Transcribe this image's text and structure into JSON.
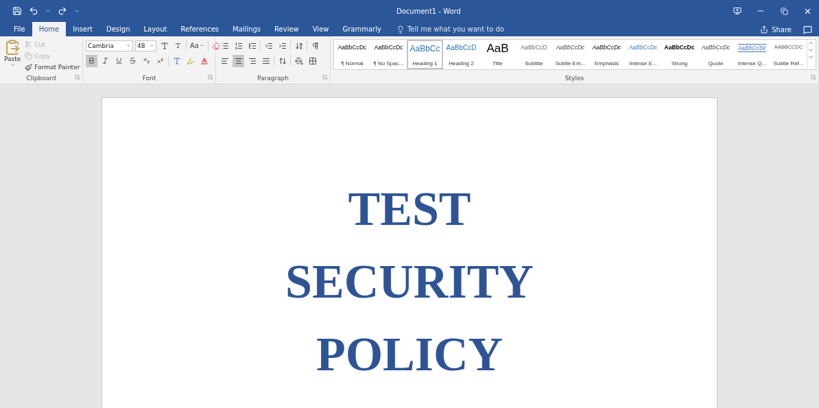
{
  "window": {
    "title": "Document1  -  Word"
  },
  "tabs": [
    {
      "label": "File",
      "selected": false
    },
    {
      "label": "Home",
      "selected": true
    },
    {
      "label": "Insert",
      "selected": false
    },
    {
      "label": "Design",
      "selected": false
    },
    {
      "label": "Layout",
      "selected": false
    },
    {
      "label": "References",
      "selected": false
    },
    {
      "label": "Mailings",
      "selected": false
    },
    {
      "label": "Review",
      "selected": false
    },
    {
      "label": "View",
      "selected": false
    },
    {
      "label": "Grammarly",
      "selected": false
    }
  ],
  "tell_me": {
    "placeholder": "Tell me what you want to do"
  },
  "share": "Share",
  "clipboard": {
    "label": "Clipboard",
    "paste": "Paste",
    "actions": [
      {
        "kind": "cut",
        "label": "Cut",
        "disabled": true
      },
      {
        "kind": "copy",
        "label": "Copy",
        "disabled": true
      },
      {
        "kind": "painter",
        "label": "Format Painter",
        "disabled": false
      }
    ]
  },
  "font": {
    "label": "Font",
    "family": "Cambria",
    "size": "48",
    "change_case": "Aa",
    "format_buttons": [
      {
        "kind": "bold",
        "selected": true
      },
      {
        "kind": "italic",
        "selected": false
      },
      {
        "kind": "underline",
        "selected": false
      },
      {
        "kind": "strikethrough",
        "selected": false
      },
      {
        "kind": "subscript",
        "selected": false
      },
      {
        "kind": "superscript",
        "selected": false
      }
    ]
  },
  "paragraph": {
    "label": "Paragraph",
    "align_buttons": [
      {
        "kind": "left",
        "selected": false
      },
      {
        "kind": "center",
        "selected": true
      },
      {
        "kind": "right",
        "selected": false
      },
      {
        "kind": "justify",
        "selected": false
      }
    ]
  },
  "styles": {
    "label": "Styles",
    "items": [
      {
        "kind": "normal",
        "preview": "AaBbCcDc",
        "name": "¶ Normal",
        "selected": false
      },
      {
        "kind": "normal",
        "preview": "AaBbCcDc",
        "name": "¶ No Spac...",
        "selected": false
      },
      {
        "kind": "heading1",
        "preview": "AaBbCc",
        "name": "Heading 1",
        "selected": true
      },
      {
        "kind": "heading2",
        "preview": "AaBbCcD",
        "name": "Heading 2",
        "selected": false
      },
      {
        "kind": "title",
        "preview": "AaB",
        "name": "Title",
        "selected": false
      },
      {
        "kind": "subtitle",
        "preview": "AaBbCcD",
        "name": "Subtitle",
        "selected": false
      },
      {
        "kind": "subtle",
        "preview": "AaBbCcDc",
        "name": "Subtle Em...",
        "selected": false
      },
      {
        "kind": "emphasis",
        "preview": "AaBbCcDc",
        "name": "Emphasis",
        "selected": false
      },
      {
        "kind": "intense",
        "preview": "AaBbCcDc",
        "name": "Intense E...",
        "selected": false
      },
      {
        "kind": "strong",
        "preview": "AaBbCcDc",
        "name": "Strong",
        "selected": false
      },
      {
        "kind": "quote",
        "preview": "AaBbCcDc",
        "name": "Quote",
        "selected": false
      },
      {
        "kind": "intensequote",
        "preview": "AaBbCcDc",
        "name": "Intense Q...",
        "selected": false
      },
      {
        "kind": "subtleref",
        "preview": "AABBCCDC",
        "name": "Subtle Ref...",
        "selected": false
      }
    ]
  },
  "document": {
    "lines": [
      "TEST",
      "SECURITY",
      "POLICY"
    ]
  }
}
